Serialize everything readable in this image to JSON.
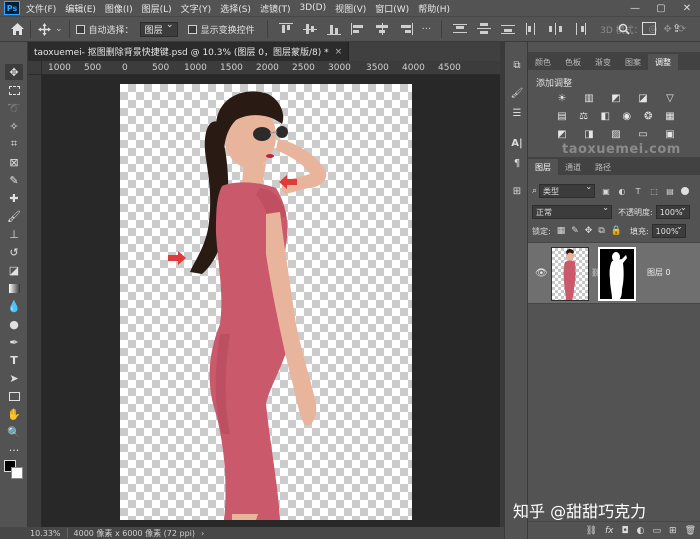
{
  "menu": {
    "items": [
      "文件(F)",
      "编辑(E)",
      "图像(I)",
      "图层(L)",
      "文字(Y)",
      "选择(S)",
      "滤镜(T)",
      "3D(D)",
      "视图(V)",
      "窗口(W)",
      "帮助(H)"
    ],
    "logo": "Ps"
  },
  "window_controls": {
    "minimize": "—",
    "maximize": "▢",
    "close": "✕"
  },
  "options": {
    "auto_select_label": "自动选择：",
    "auto_select_value": "图层",
    "show_transform_label": "显示变换控件",
    "mode_3d_label": "3D 模式："
  },
  "document_tab": {
    "title": "taoxuemei- 抠图删除背景快捷键.psd @ 10.3% (图层 0，图层蒙版/8) *",
    "close": "×"
  },
  "ruler": {
    "labels": [
      "1000",
      "500",
      "0",
      "500",
      "1000",
      "1500",
      "2000",
      "2500",
      "3000",
      "3500",
      "4000",
      "4500"
    ]
  },
  "status": {
    "zoom": "10.33%",
    "doc_info": "4000 像素 x 6000 像素 (72 ppi)",
    "arrow": "›"
  },
  "panel_top": {
    "tabs": [
      "颜色",
      "色板",
      "渐变",
      "图案",
      "调整"
    ],
    "active_tab": "调整",
    "add_adjustment": "添加调整",
    "watermark": "taoxuemei.com"
  },
  "layers_panel": {
    "tabs": [
      "图层",
      "通道",
      "路径"
    ],
    "active_tab": "图层",
    "filter_kind": "类型",
    "blend_mode": "正常",
    "opacity_label": "不透明度:",
    "opacity_value": "100%",
    "lock_label": "锁定:",
    "fill_label": "填充:",
    "fill_value": "100%",
    "layer_name": "图层 0"
  },
  "footer_watermark": "知乎 @甜甜巧克力",
  "colors": {
    "accent": "#31a8ff",
    "arrow_red": "#e03a3a",
    "dress": "#c9596b"
  }
}
